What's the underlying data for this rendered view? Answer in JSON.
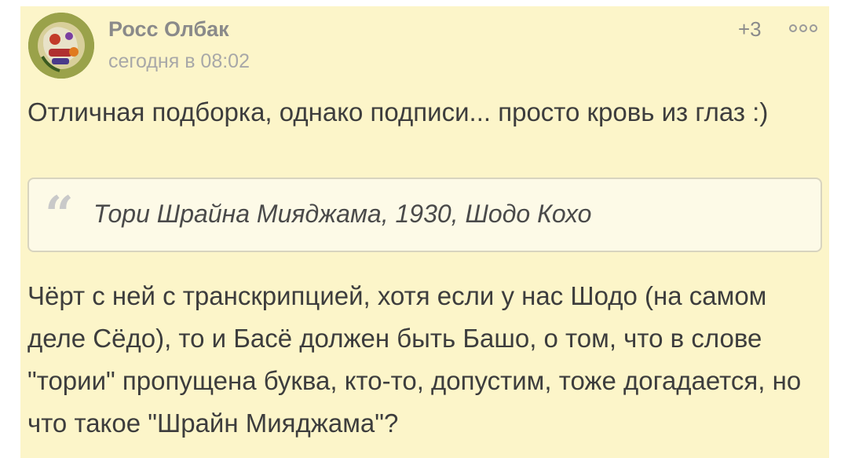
{
  "comment": {
    "author": "Росс Олбак",
    "timestamp": "сегодня в 08:02",
    "rating": "+3",
    "more_icon": "more-dots-icon",
    "paragraph1": "Отличная подборка, однако подписи... просто кровь из глаз :)",
    "quote": {
      "icon": "quote-icon",
      "mark": "“",
      "text": "Тори Шрайна Мияджама, 1930, Шодо Кохо"
    },
    "paragraph2": "Чёрт с ней с транскрипцией, хотя если у нас Шодо (на самом деле Сёдо), то и Басё должен быть Башо, о том, что в слове \"тории\" пропущена буква, кто-то, допустим, тоже догадается, но что такое \"Шрайн Мияджама\"?"
  },
  "colors": {
    "card_background": "#fcf5c9",
    "quote_background": "#fdfae7",
    "text": "#3d3d3d",
    "muted": "#8a8a8a"
  }
}
